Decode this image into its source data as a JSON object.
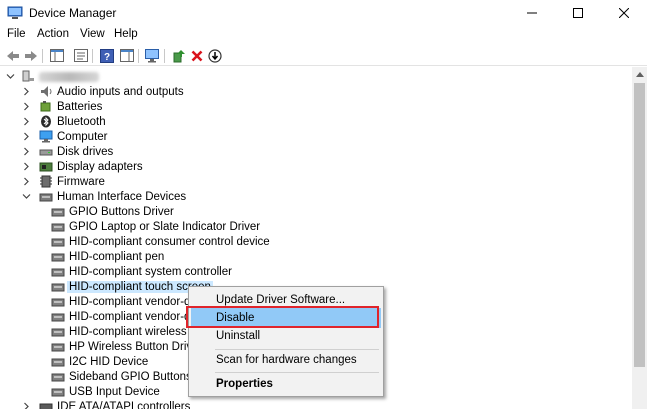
{
  "window": {
    "title": "Device Manager"
  },
  "menubar": {
    "items": [
      "File",
      "Action",
      "View",
      "Help"
    ]
  },
  "tree": {
    "categories": [
      "Audio inputs and outputs",
      "Batteries",
      "Bluetooth",
      "Computer",
      "Disk drives",
      "Display adapters",
      "Firmware",
      "Human Interface Devices"
    ],
    "hid_children": [
      "GPIO Buttons Driver",
      "GPIO Laptop or Slate Indicator Driver",
      "HID-compliant consumer control device",
      "HID-compliant pen",
      "HID-compliant system controller",
      "HID-compliant touch screen",
      "HID-compliant vendor-def",
      "HID-compliant vendor-def",
      "HID-compliant wireless rac",
      "HP Wireless Button Driver",
      "I2C HID Device",
      "Sideband GPIO Buttons Inje",
      "USB Input Device"
    ],
    "next_category": "IDE ATA/ATAPI controllers"
  },
  "context_menu": {
    "items": [
      "Update Driver Software...",
      "Disable",
      "Uninstall",
      "Scan for hardware changes",
      "Properties"
    ]
  },
  "colors": {
    "selection": "#cce8ff",
    "menu_highlight": "#91c9f7",
    "annotation_red": "#e0242b"
  }
}
